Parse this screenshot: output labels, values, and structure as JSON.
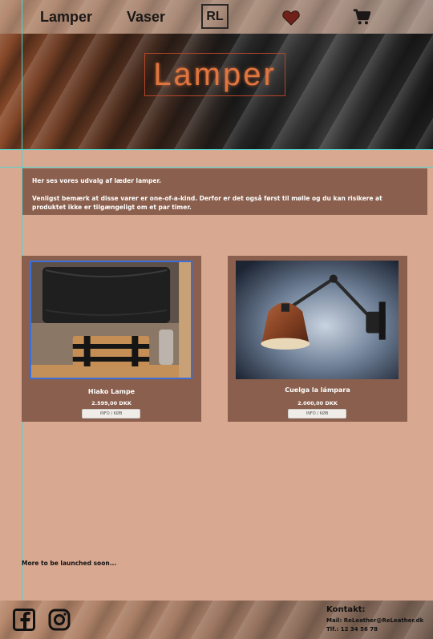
{
  "nav": {
    "lamper": "Lamper",
    "vaser": "Vaser",
    "logo": "RL",
    "heart_icon": "heart-icon",
    "cart_icon": "cart-icon"
  },
  "hero": {
    "title": "Lamper"
  },
  "intro": {
    "line1": "Her ses vores udvalg af læder lamper.",
    "line2": "Venligst bemærk at disse varer er one-of-a-kind. Derfor er det også først til mølle og du kan risikere at produktet ikke er tilgængeligt om et par timer."
  },
  "products": [
    {
      "name": "Hiako Lampe",
      "price": "2.599,00 DKK",
      "button": "INFO / KØB"
    },
    {
      "name": "Cuelga la lámpara",
      "price": "2.000,00 DKK",
      "button": "INFO / KØB"
    }
  ],
  "soon": "More to be launched soon...",
  "footer": {
    "contact_title": "Kontakt:",
    "mail": "Mail: ReLeather@ReLeather.dk",
    "tel": "Tlf.: 12 34 56 78",
    "facebook_icon": "facebook-icon",
    "instagram_icon": "instagram-icon"
  },
  "colors": {
    "background": "#d9a891",
    "panel": "#8a5f4d",
    "guide": "#4fd6d0",
    "hero_title": "#e0753f"
  }
}
